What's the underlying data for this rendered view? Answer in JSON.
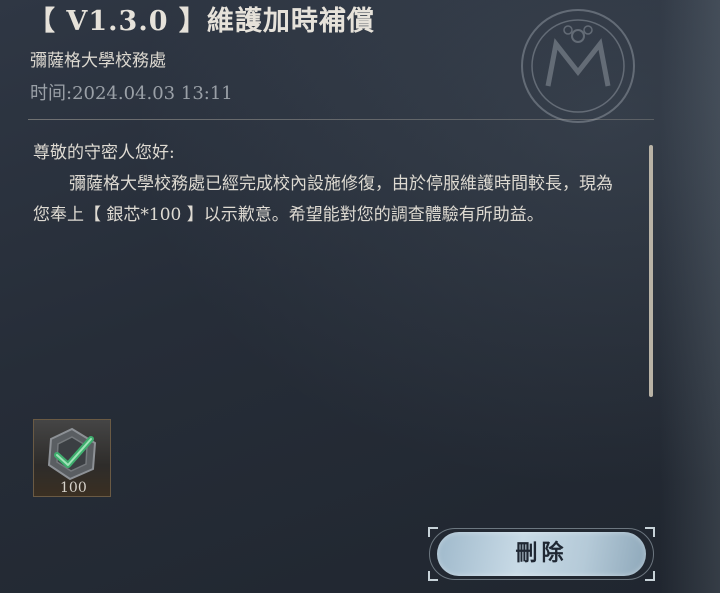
{
  "mail": {
    "title": "【 V1.3.0 】維護加時補償",
    "sender": "彌薩格大學校務處",
    "time_label": "时间:",
    "time_value": "2024.04.03 13:11",
    "greeting": "尊敬的守密人您好:",
    "content": "彌薩格大學校務處已經完成校內設施修復，由於停服維護時間較長，現為您奉上【 銀芯*100 】以示歉意。希望能對您的調查體驗有所助益。"
  },
  "attachment": {
    "icon": "silver-core-icon",
    "count": "100"
  },
  "actions": {
    "delete_label": "刪除"
  },
  "colors": {
    "background": "#262d38",
    "text": "#dedad2",
    "muted_text": "#9aa0a7",
    "button_face": "#b5cad8",
    "accent_green": "#3fae6e"
  }
}
